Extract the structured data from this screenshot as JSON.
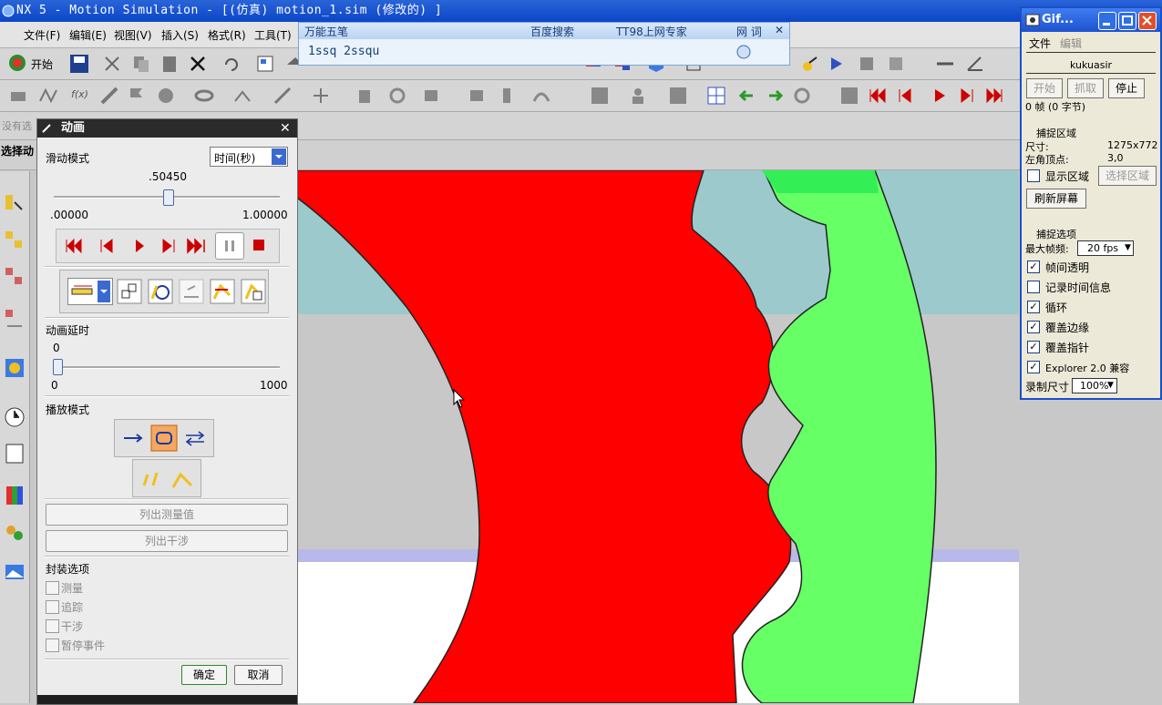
{
  "window": {
    "title": "NX 5 - Motion Simulation - [(仿真) motion_1.sim  (修改的) ]"
  },
  "menu": [
    "文件(F)",
    "编辑(E)",
    "视图(V)",
    "插入(S)",
    "格式(R)",
    "工具(T)"
  ],
  "toolbar": {
    "start_label": "开始"
  },
  "ime": {
    "tabs": [
      "万能五笔",
      "百度搜索",
      "TT98上网专家",
      "网 词"
    ],
    "input_text": "1ssq 2ssqu"
  },
  "selection_bar": {
    "left_label": "没有选",
    "filter_label": "选择动"
  },
  "animation_dialog": {
    "title": "动画",
    "slide_mode_label": "滑动模式",
    "slide_mode_value": "时间(秒)",
    "time_value": ".50450",
    "time_min": ".00000",
    "time_max": "1.00000",
    "time_fraction": 0.5045,
    "delay_label": "动画延时",
    "delay_value": "0",
    "delay_min": "0",
    "delay_max": "1000",
    "play_mode_label": "播放模式",
    "list_measure_button": "列出测量值",
    "list_interference_button": "列出干涉",
    "package_options_label": "封装选项",
    "package_options": [
      "测量",
      "追踪",
      "干涉",
      "暂停事件"
    ],
    "ok_button": "确定",
    "cancel_button": "取消"
  },
  "gif_panel": {
    "title": "Gif...",
    "menu_file": "文件",
    "menu_edit": "编辑",
    "user": "kukuasir",
    "start_button": "开始",
    "capture_button": "抓取",
    "stop_button": "停止",
    "frames_text": "0 帧 (0 字节)",
    "capture_area_header": "捕捉区域",
    "size_label": "尺寸:",
    "size_value": "1275x772",
    "corner_label": "左角顶点:",
    "corner_value": "3,0",
    "show_area_label": "显示区域",
    "select_area_button": "选择区域",
    "refresh_button": "刷新屏幕",
    "capture_options_header": "捕捉选项",
    "max_fps_label": "最大帧频:",
    "max_fps_value": "20 fps",
    "options": [
      {
        "label": "帧间透明",
        "checked": true
      },
      {
        "label": "记录时间信息",
        "checked": false
      },
      {
        "label": "循环",
        "checked": true
      },
      {
        "label": "覆盖边缘",
        "checked": true
      },
      {
        "label": "覆盖指针",
        "checked": true
      },
      {
        "label": "Explorer 2.0 兼容",
        "checked": true
      }
    ],
    "record_size_label": "录制尺寸",
    "record_size_value": "100%"
  },
  "colors": {
    "gear_red": "#ff0000",
    "gear_green": "#66ff66",
    "teal": "#9ccacc",
    "grey": "#c8c8c8"
  }
}
